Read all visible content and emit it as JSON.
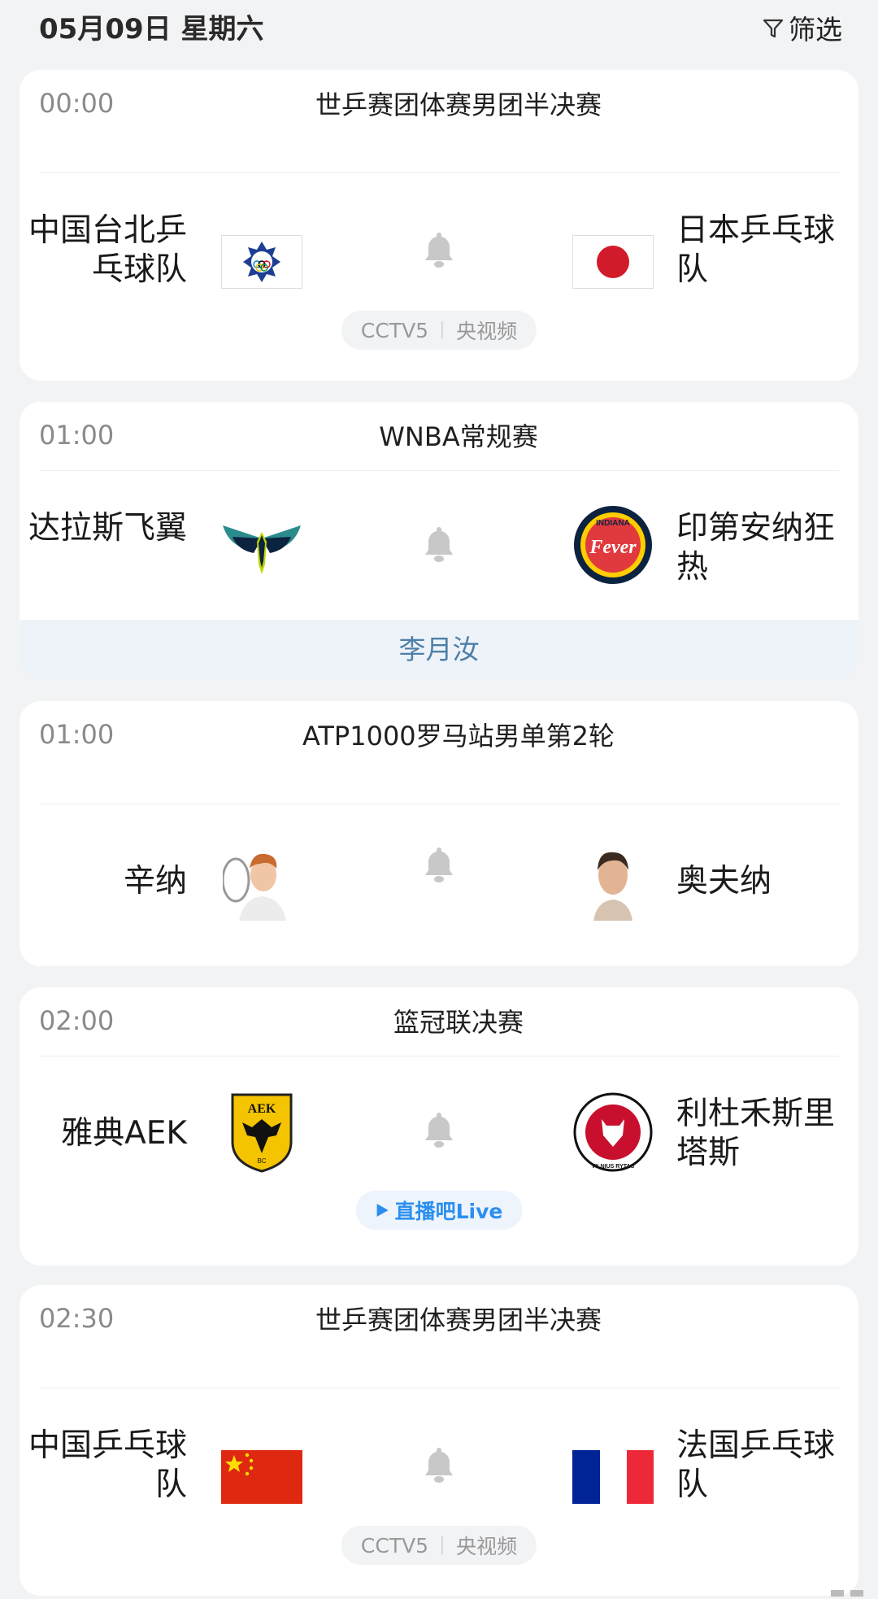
{
  "header": {
    "date": "05月09日 星期六",
    "filter_label": "筛选"
  },
  "matches": [
    {
      "time": "00:00",
      "title": "世乒赛团体赛男团半决赛",
      "home": "中国台北乒乓球队",
      "away": "日本乒乓球队",
      "broadcast": [
        "CCTV5",
        "央视频"
      ]
    },
    {
      "time": "01:00",
      "title": "WNBA常规赛",
      "home": "达拉斯飞翼",
      "away": "印第安纳狂热",
      "featured": "李月汝"
    },
    {
      "time": "01:00",
      "title": "ATP1000罗马站男单第2轮",
      "home": "辛纳",
      "away": "奥夫纳"
    },
    {
      "time": "02:00",
      "title": "篮冠联决赛",
      "home": "雅典AEK",
      "away": "利杜禾斯里塔斯",
      "live_label": "直播吧Live",
      "home_logo_text": "AEK",
      "away_logo_text": "VILNIUS RYTAS"
    },
    {
      "time": "02:30",
      "title": "世乒赛团体赛男团半决赛",
      "home": "中国乒乓球队",
      "away": "法国乒乓球队",
      "broadcast": [
        "CCTV5",
        "央视频"
      ]
    }
  ],
  "logos": {
    "aek_sub": "BC",
    "fever_top": "INDIANA",
    "fever_main": "Fever"
  },
  "icons": [
    "filter-icon",
    "bell-icon",
    "play-icon"
  ],
  "colors": {
    "live_blue": "#2b8ff0",
    "featured_text": "#4d7fa8",
    "bell_gray": "#c8c8c8"
  }
}
